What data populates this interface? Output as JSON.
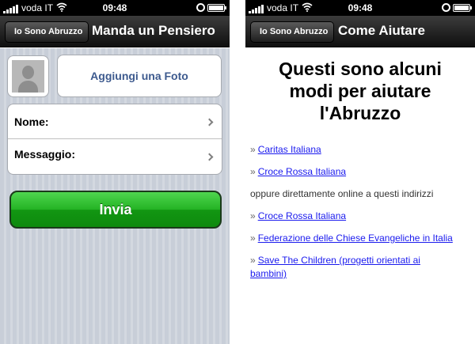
{
  "status_bar": {
    "carrier": "voda IT",
    "time": "09:48"
  },
  "left_screen": {
    "nav": {
      "back_label": "Io Sono Abruzzo",
      "title": "Manda un Pensiero"
    },
    "add_photo_label": "Aggiungi una Foto",
    "form": {
      "name_label": "Nome:",
      "message_label": "Messaggio:"
    },
    "send_label": "Invia"
  },
  "right_screen": {
    "nav": {
      "back_label": "Io Sono Abruzzo",
      "title": "Come Aiutare"
    },
    "heading_lines": [
      "Questi sono alcuni",
      "modi per aiutare",
      "l'Abruzzo"
    ],
    "bullet_char": "»",
    "links": [
      "Caritas Italiana",
      "Croce Rossa Italiana",
      "Croce Rossa Italiana",
      "Federazione delle Chiese Evangeliche in Italia",
      "Save The Children (progetti orientati ai bambini)"
    ],
    "online_text": "oppure direttamente online a questi indirizzi"
  },
  "colors": {
    "accent_green": "#24b324",
    "link_blue": "#1a1aee",
    "nav_dark": "#1e1e1e"
  }
}
